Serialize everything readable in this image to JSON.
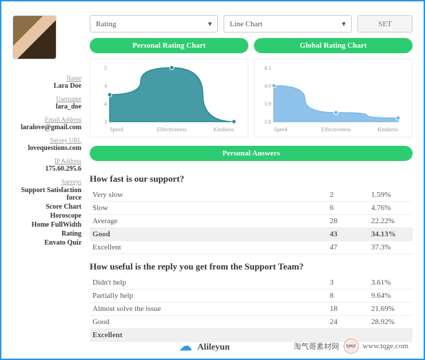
{
  "profile": {
    "name_label": "Name",
    "name": "Lara Doe",
    "username_label": "Username",
    "username": "lara_doe",
    "email_label": "Email Address",
    "email": "laralove@gmail.com",
    "survey_url_label": "Survey URL",
    "survey_url": "lovequestions.com",
    "ip_label": "IP Address",
    "ip": "175.60.295.6",
    "surveys_label": "Surveys",
    "surveys": [
      "Support Satisfaction force",
      "Score Chart",
      "Horoscope",
      "Home FullWidth",
      "Rating",
      "Envato Quiz"
    ]
  },
  "controls": {
    "select1": "Rating",
    "select2": "Line Chart",
    "set_btn": "SET"
  },
  "chart_titles": {
    "personal": "Personal Rating Chart",
    "global": "Global Rating Chart"
  },
  "answers_title": "Personal Answers",
  "chart_data": [
    {
      "type": "area",
      "title": "Personal Rating Chart",
      "categories": [
        "Speed",
        "Effectiveness",
        "Kindness"
      ],
      "values": [
        4,
        5,
        3
      ],
      "ylim": [
        3,
        5
      ],
      "color": "#268a96"
    },
    {
      "type": "area",
      "title": "Global Rating Chart",
      "categories": [
        "Speed",
        "Effectiveness",
        "Kindness"
      ],
      "values": [
        4.0,
        3.85,
        3.82
      ],
      "ylim": [
        3.8,
        4.1
      ],
      "color": "#7cb8e8"
    }
  ],
  "questions": [
    {
      "title": "How fast is our support?",
      "rows": [
        {
          "label": "Very slow",
          "count": "2",
          "pct": "1.59%"
        },
        {
          "label": "Slow",
          "count": "6",
          "pct": "4.76%"
        },
        {
          "label": "Average",
          "count": "28",
          "pct": "22.22%"
        },
        {
          "label": "Good",
          "count": "43",
          "pct": "34.13%",
          "hl": true
        },
        {
          "label": "Excellent",
          "count": "47",
          "pct": "37.3%"
        }
      ]
    },
    {
      "title": "How useful is the reply you get from the Support Team?",
      "rows": [
        {
          "label": "Didn't help",
          "count": "3",
          "pct": "3.61%"
        },
        {
          "label": "Partially help",
          "count": "8",
          "pct": "9.64%"
        },
        {
          "label": "Almost solve the issue",
          "count": "18",
          "pct": "21.69%"
        },
        {
          "label": "Good",
          "count": "24",
          "pct": "28.92%"
        },
        {
          "label": "Excellent",
          "count": "",
          "pct": "",
          "hl": true
        }
      ]
    }
  ],
  "footer": {
    "brand": "Alileyun",
    "right_text": "淘气哥素材网",
    "right_url": "www.tqge.com"
  }
}
